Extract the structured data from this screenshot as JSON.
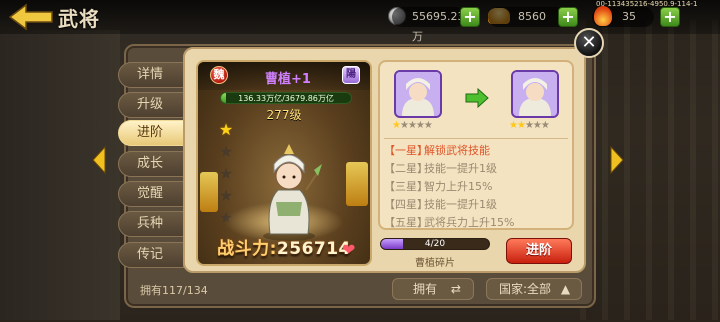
{
  "topbar": {
    "title": "武将",
    "silver": "55695.23万",
    "gold": "8560",
    "stamina": "35",
    "debug_id": "00-113435216-4950.9-114-1"
  },
  "tabs": [
    {
      "label": "详情",
      "active": false
    },
    {
      "label": "升级",
      "active": false
    },
    {
      "label": "进阶",
      "active": true
    },
    {
      "label": "成长",
      "active": false
    },
    {
      "label": "觉醒",
      "active": false
    },
    {
      "label": "兵种",
      "active": false
    },
    {
      "label": "传记",
      "active": false
    }
  ],
  "hero": {
    "name": "曹植+1",
    "faction_badge": "魏",
    "info_badge": "陽",
    "exp_text": "136.33万亿/3679.86万亿",
    "exp_fraction": 0.037,
    "level": "277级",
    "stars_filled": 1,
    "stars_total": 5,
    "power_label": "战斗力:",
    "power_value": "256714"
  },
  "upgrade": {
    "from_stars": 1,
    "to_stars": 2,
    "total_stars": 5,
    "effects": [
      {
        "tier": "【一星】",
        "text": "解锁武将技能",
        "unlocked": true
      },
      {
        "tier": "【二星】",
        "text": "技能一提升1级",
        "unlocked": false
      },
      {
        "tier": "【三星】",
        "text": "智力上升15%",
        "unlocked": false
      },
      {
        "tier": "【四星】",
        "text": "技能一提升1级",
        "unlocked": false
      },
      {
        "tier": "【五星】",
        "text": "武将兵力上升15%",
        "unlocked": false
      }
    ],
    "fragment_text": "4/20",
    "fragment_fraction": 0.2,
    "fragment_name": "曹植碎片",
    "advance_label": "进阶"
  },
  "footer": {
    "owned_count": "拥有117/134",
    "owned_button": "拥有",
    "country_button": "国家:全部"
  },
  "colors": {
    "accent_red": "#c8200e",
    "unlocked_effect": "#e0542a",
    "hero_name": "#d080ff"
  }
}
